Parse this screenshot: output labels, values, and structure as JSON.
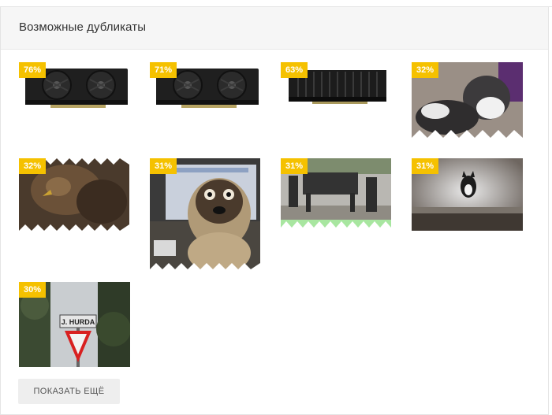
{
  "panel": {
    "title": "Возможные дубликаты"
  },
  "thumbnails": [
    {
      "name": "gpu-card-1",
      "percent": "76%"
    },
    {
      "name": "gpu-card-2",
      "percent": "71%"
    },
    {
      "name": "gpu-card-3",
      "percent": "63%"
    },
    {
      "name": "cat-photo",
      "percent": "32%"
    },
    {
      "name": "eagle-photo",
      "percent": "32%"
    },
    {
      "name": "pug-photo",
      "percent": "31%"
    },
    {
      "name": "robot-dogs-photo",
      "percent": "31%"
    },
    {
      "name": "jumping-dog-photo",
      "percent": "31%"
    },
    {
      "name": "road-sign-photo",
      "percent": "30%"
    }
  ],
  "sign_text": "J. HURDA",
  "more_button": {
    "label": "ПОКАЗАТЬ ЕЩЁ"
  },
  "colors": {
    "badge": "#f5c100",
    "header_bg": "#f6f6f6",
    "button_bg": "#eeeeee"
  }
}
